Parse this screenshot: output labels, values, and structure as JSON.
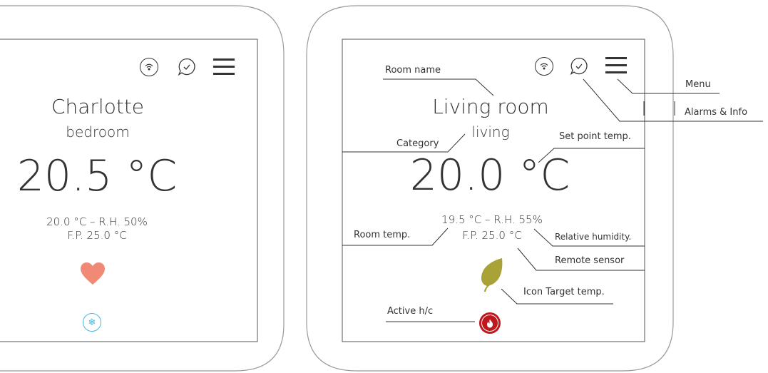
{
  "left_screen": {
    "room_name": "Charlotte",
    "category": "bedroom",
    "main_temp": "20.5 °C",
    "line1": "20.0 °C – R.H. 50%",
    "line2": "F.P. 25.0 °C",
    "icons": [
      "wifi-icon",
      "chat-check-icon",
      "menu-icon",
      "heart-icon",
      "snowflake-icon"
    ],
    "heart_color": "#f08a76",
    "snow_color": "#4ab7dc"
  },
  "right_screen": {
    "room_name": "Living room",
    "category": "living",
    "main_temp": "20.0 °C",
    "line1": "19.5 °C – R.H. 55%",
    "line2": "F.P. 25.0 °C",
    "icons": [
      "wifi-icon",
      "chat-check-icon",
      "menu-icon",
      "leaf-icon",
      "flame-icon"
    ],
    "leaf_color": "#a9a237",
    "flame_color": "#c0171d"
  },
  "callouts": {
    "room_name": "Room name",
    "menu": "Menu",
    "alarms": "Alarms & Info",
    "category": "Category",
    "set_point": "Set point temp.",
    "room_temp": "Room temp.",
    "humidity": "Relative humidity.",
    "remote_sensor": "Remote sensor",
    "icon_target": "Icon Target temp.",
    "active_hc": "Active h/c"
  }
}
